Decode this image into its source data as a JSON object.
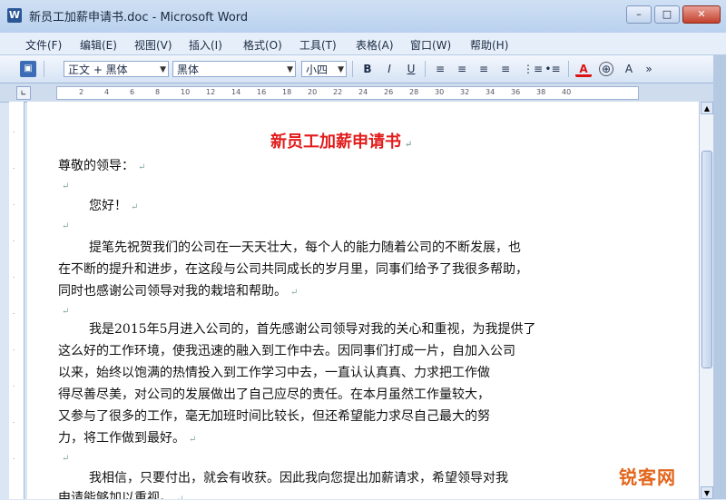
{
  "window": {
    "title": "新员工加薪申请书.doc - Microsoft Word",
    "app_icon": "W",
    "minimize": "–",
    "maximize": "□",
    "close": "✕"
  },
  "menubar": {
    "items": [
      {
        "label": "文件(F)"
      },
      {
        "label": "编辑(E)"
      },
      {
        "label": "视图(V)"
      },
      {
        "label": "插入(I)"
      },
      {
        "label": "格式(O)"
      },
      {
        "label": "工具(T)"
      },
      {
        "label": "表格(A)"
      },
      {
        "label": "窗口(W)"
      },
      {
        "label": "帮助(H)"
      }
    ]
  },
  "toolbar": {
    "style_value": "正文 + 黑体",
    "font_value": "黑体",
    "size_value": "小四",
    "bold": "B",
    "italic": "I",
    "underline": "U",
    "font_color_icon": "A",
    "highlight_icon": "A"
  },
  "ruler": {
    "ticks": [
      "2",
      "4",
      "6",
      "8",
      "10",
      "12",
      "14",
      "16",
      "18",
      "20",
      "22",
      "24",
      "26",
      "28",
      "30",
      "32",
      "34",
      "36",
      "38",
      "40"
    ]
  },
  "document": {
    "title": "新员工加薪申请书",
    "lines": [
      "尊敬的领导：",
      "您好！",
      "提笔先祝贺我们的公司在一天天壮大，每个人的能力随着公司的不断发展，也",
      "在不断的提升和进步，在这段与公司共同成长的岁月里，同事们给予了我很多帮助，",
      "同时也感谢公司领导对我的栽培和帮助。",
      "我是2015年5月进入公司的，首先感谢公司领导对我的关心和重视，为我提供了",
      "这么好的工作环境，使我迅速的融入到工作中去。因同事们打成一片，自加入公司",
      "以来，始终以饱满的热情投入到工作学习中去，一直认认真真、力求把工作做",
      "得尽善尽美，对公司的发展做出了自己应尽的责任。在本月虽然工作量较大，",
      "又参与了很多的工作，毫无加班时间比较长，但还希望能力求尽自己最大的努",
      "力，将工作做到最好。",
      "我相信，只要付出，就会有收获。因此我向您提出加薪请求，希望领导对我",
      "申请能够加以重视。"
    ]
  },
  "watermark": "锐客网"
}
